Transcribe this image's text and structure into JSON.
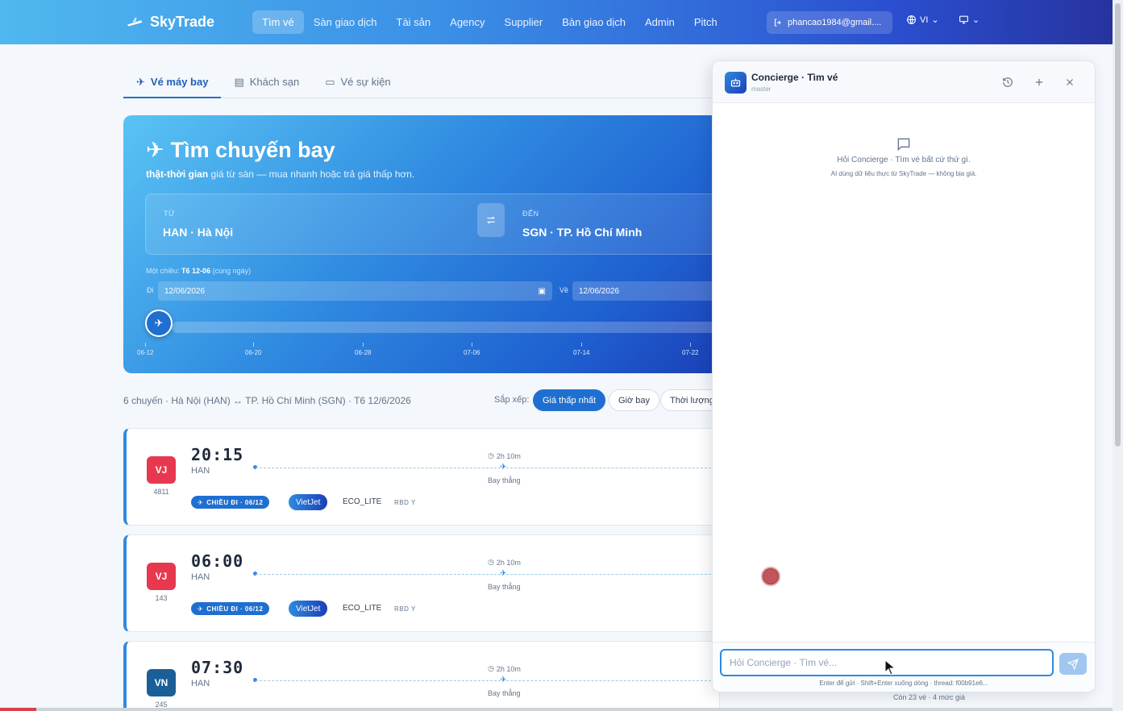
{
  "header": {
    "brand": "SkyTrade",
    "nav": [
      "Tìm vé",
      "Sàn giao dịch",
      "Tài sản",
      "Agency",
      "Supplier",
      "Bàn giao dịch",
      "Admin",
      "Pitch"
    ],
    "active_nav": "Tìm vé",
    "user_email": "phancao1984@gmail....",
    "language": "VI"
  },
  "tabs": [
    {
      "label": "Vé máy bay",
      "icon": "plane-icon",
      "active": true
    },
    {
      "label": "Khách sạn",
      "icon": "building-icon",
      "active": false
    },
    {
      "label": "Vé sự kiện",
      "icon": "ticket-icon",
      "active": false
    }
  ],
  "hero": {
    "title": "Tìm chuyến bay",
    "subtitle_bold": "thật-thời gian",
    "subtitle_rest": " giá từ sàn — mua nhanh hoặc trả giá thấp hơn.",
    "from_label": "TỪ",
    "from_value": "HAN · Hà Nội",
    "to_label": "ĐẾN",
    "to_value": "SGN · TP. Hồ Chí Minh",
    "trip_prefix": "Một chiều:",
    "trip_date": "T6 12-06",
    "trip_note": "(cùng ngày)",
    "depart_label": "Đi",
    "depart_date": "12/06/2026",
    "return_label": "Về",
    "return_date": "12/06/2026",
    "ticks": [
      "06-12",
      "06-20",
      "06-28",
      "07-06",
      "07-14",
      "07-22"
    ]
  },
  "results": {
    "summary": "6 chuyến · Hà Nội (HAN) ↔ TP. Hồ Chí Minh (SGN) · T6 12/6/2026",
    "sort_label": "Sắp xếp:",
    "sort_options": [
      "Giá thấp nhất",
      "Giờ bay",
      "Thời lượng"
    ],
    "active_sort": "Giá thấp nhất",
    "offers_note": "Còn 23 vé · 4 mức giá"
  },
  "flights": [
    {
      "code": "VJ",
      "color": "#e8384f",
      "number": "4811",
      "time": "20:15",
      "airport": "HAN",
      "duration": "2h 10m",
      "stop": "Bay thẳng",
      "direction": "CHIỀU ĐI · 06/12",
      "airline": "VietJet",
      "fare": "ECO_LITE",
      "rbd": "RBD Y"
    },
    {
      "code": "VJ",
      "color": "#e8384f",
      "number": "143",
      "time": "06:00",
      "airport": "HAN",
      "duration": "2h 10m",
      "stop": "Bay thẳng",
      "direction": "CHIỀU ĐI · 06/12",
      "airline": "VietJet",
      "fare": "ECO_LITE",
      "rbd": "RBD Y"
    },
    {
      "code": "VN",
      "color": "#1a5f98",
      "number": "245",
      "time": "07:30",
      "airport": "HAN",
      "duration": "2h 10m",
      "stop": "Bay thẳng",
      "direction": "",
      "airline": "",
      "fare": "",
      "rbd": ""
    }
  ],
  "concierge": {
    "title": "Concierge · Tìm vé",
    "subtitle": "master",
    "empty_title": "Hỏi Concierge · Tìm vé bất cứ thứ gì.",
    "empty_sub": "AI dùng dữ liệu thực từ SkyTrade — không bịa giá.",
    "input_placeholder": "Hỏi Concierge · Tìm vé...",
    "hint": "Enter để gửi · Shift+Enter xuống dòng · thread: f00b91e6..."
  }
}
